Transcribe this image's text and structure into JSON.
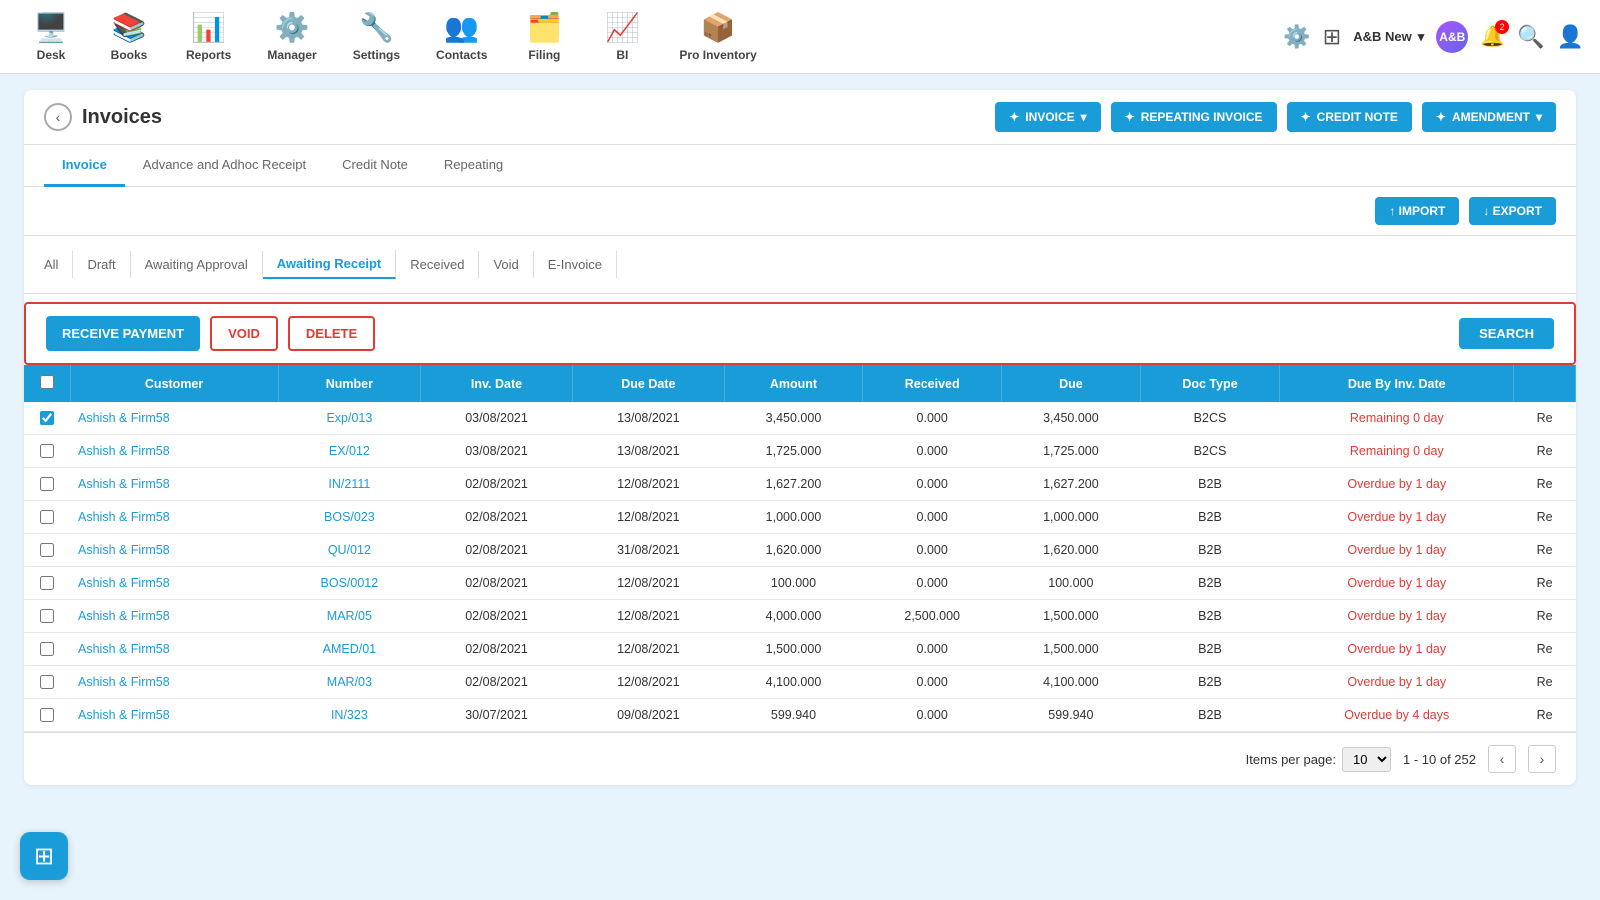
{
  "topNav": {
    "items": [
      {
        "id": "desk",
        "label": "Desk",
        "icon": "🖥️"
      },
      {
        "id": "books",
        "label": "Books",
        "icon": "📚"
      },
      {
        "id": "reports",
        "label": "Reports",
        "icon": "📊"
      },
      {
        "id": "manager",
        "label": "Manager",
        "icon": "⚙️"
      },
      {
        "id": "settings",
        "label": "Settings",
        "icon": "🔧"
      },
      {
        "id": "contacts",
        "label": "Contacts",
        "icon": "👥"
      },
      {
        "id": "filing",
        "label": "Filing",
        "icon": "🗂️"
      },
      {
        "id": "bi",
        "label": "BI",
        "icon": "📈"
      },
      {
        "id": "pro_inventory",
        "label": "Pro Inventory",
        "icon": "📦"
      }
    ],
    "user": "A&B New",
    "notificationCount": "2"
  },
  "page": {
    "title": "Invoices",
    "backLabel": "‹"
  },
  "headerButtons": [
    {
      "id": "invoice-btn",
      "label": "INVOICE",
      "icon": "+"
    },
    {
      "id": "repeating-invoice-btn",
      "label": "REPEATING INVOICE",
      "icon": "+"
    },
    {
      "id": "credit-note-btn",
      "label": "CREDIT NOTE",
      "icon": "+"
    },
    {
      "id": "amendment-btn",
      "label": "AMENDMENT",
      "icon": "+"
    }
  ],
  "tabs": [
    {
      "id": "invoice",
      "label": "Invoice",
      "active": true
    },
    {
      "id": "advance",
      "label": "Advance and Adhoc Receipt",
      "active": false
    },
    {
      "id": "credit-note",
      "label": "Credit Note",
      "active": false
    },
    {
      "id": "repeating",
      "label": "Repeating",
      "active": false
    }
  ],
  "toolbarButtons": [
    {
      "id": "import-btn",
      "label": "↑ IMPORT"
    },
    {
      "id": "export-btn",
      "label": "↓ EXPORT"
    }
  ],
  "filterTabs": [
    {
      "id": "all",
      "label": "All"
    },
    {
      "id": "draft",
      "label": "Draft"
    },
    {
      "id": "awaiting-approval",
      "label": "Awaiting Approval"
    },
    {
      "id": "awaiting-receipt",
      "label": "Awaiting Receipt",
      "active": true
    },
    {
      "id": "received",
      "label": "Received"
    },
    {
      "id": "void",
      "label": "Void"
    },
    {
      "id": "e-invoice",
      "label": "E-Invoice"
    }
  ],
  "actionButtons": {
    "receive": "RECEIVE PAYMENT",
    "void": "VOID",
    "delete": "DELETE",
    "search": "SEARCH"
  },
  "tableHeaders": [
    "",
    "Customer",
    "Number",
    "Inv. Date",
    "Due Date",
    "Amount",
    "Received",
    "Due",
    "Doc Type",
    "Due By Inv. Date",
    ""
  ],
  "tableRows": [
    {
      "checked": true,
      "customer": "Ashish & Firm58",
      "number": "Exp/013",
      "invDate": "03/08/2021",
      "dueDate": "13/08/2021",
      "amount": "3,450.000",
      "received": "0.000",
      "due": "3,450.000",
      "docType": "B2CS",
      "dueByDate": "Remaining 0 day",
      "dueColor": "red",
      "tail": "Re"
    },
    {
      "checked": false,
      "customer": "Ashish & Firm58",
      "number": "EX/012",
      "invDate": "03/08/2021",
      "dueDate": "13/08/2021",
      "amount": "1,725.000",
      "received": "0.000",
      "due": "1,725.000",
      "docType": "B2CS",
      "dueByDate": "Remaining 0 day",
      "dueColor": "red",
      "tail": "Re"
    },
    {
      "checked": false,
      "customer": "Ashish & Firm58",
      "number": "IN/2111",
      "invDate": "02/08/2021",
      "dueDate": "12/08/2021",
      "amount": "1,627.200",
      "received": "0.000",
      "due": "1,627.200",
      "docType": "B2B",
      "dueByDate": "Overdue by 1 day",
      "dueColor": "red",
      "tail": "Re"
    },
    {
      "checked": false,
      "customer": "Ashish & Firm58",
      "number": "BOS/023",
      "invDate": "02/08/2021",
      "dueDate": "12/08/2021",
      "amount": "1,000.000",
      "received": "0.000",
      "due": "1,000.000",
      "docType": "B2B",
      "dueByDate": "Overdue by 1 day",
      "dueColor": "red",
      "tail": "Re"
    },
    {
      "checked": false,
      "customer": "Ashish & Firm58",
      "number": "QU/012",
      "invDate": "02/08/2021",
      "dueDate": "31/08/2021",
      "amount": "1,620.000",
      "received": "0.000",
      "due": "1,620.000",
      "docType": "B2B",
      "dueByDate": "Overdue by 1 day",
      "dueColor": "red",
      "tail": "Re"
    },
    {
      "checked": false,
      "customer": "Ashish & Firm58",
      "number": "BOS/0012",
      "invDate": "02/08/2021",
      "dueDate": "12/08/2021",
      "amount": "100.000",
      "received": "0.000",
      "due": "100.000",
      "docType": "B2B",
      "dueByDate": "Overdue by 1 day",
      "dueColor": "red",
      "tail": "Re"
    },
    {
      "checked": false,
      "customer": "Ashish & Firm58",
      "number": "MAR/05",
      "invDate": "02/08/2021",
      "dueDate": "12/08/2021",
      "amount": "4,000.000",
      "received": "2,500.000",
      "due": "1,500.000",
      "docType": "B2B",
      "dueByDate": "Overdue by 1 day",
      "dueColor": "red",
      "tail": "Re"
    },
    {
      "checked": false,
      "customer": "Ashish & Firm58",
      "number": "AMED/01",
      "invDate": "02/08/2021",
      "dueDate": "12/08/2021",
      "amount": "1,500.000",
      "received": "0.000",
      "due": "1,500.000",
      "docType": "B2B",
      "dueByDate": "Overdue by 1 day",
      "dueColor": "red",
      "tail": "Re"
    },
    {
      "checked": false,
      "customer": "Ashish & Firm58",
      "number": "MAR/03",
      "invDate": "02/08/2021",
      "dueDate": "12/08/2021",
      "amount": "4,100.000",
      "received": "0.000",
      "due": "4,100.000",
      "docType": "B2B",
      "dueByDate": "Overdue by 1 day",
      "dueColor": "red",
      "tail": "Re"
    },
    {
      "checked": false,
      "customer": "Ashish & Firm58",
      "number": "IN/323",
      "invDate": "30/07/2021",
      "dueDate": "09/08/2021",
      "amount": "599.940",
      "received": "0.000",
      "due": "599.940",
      "docType": "B2B",
      "dueByDate": "Overdue by 4 days",
      "dueColor": "red",
      "tail": "Re"
    }
  ],
  "pagination": {
    "itemsPerPageLabel": "Items per page:",
    "itemsPerPage": "10",
    "pageInfo": "1 - 10 of 252",
    "totalLabel": "of 252"
  }
}
